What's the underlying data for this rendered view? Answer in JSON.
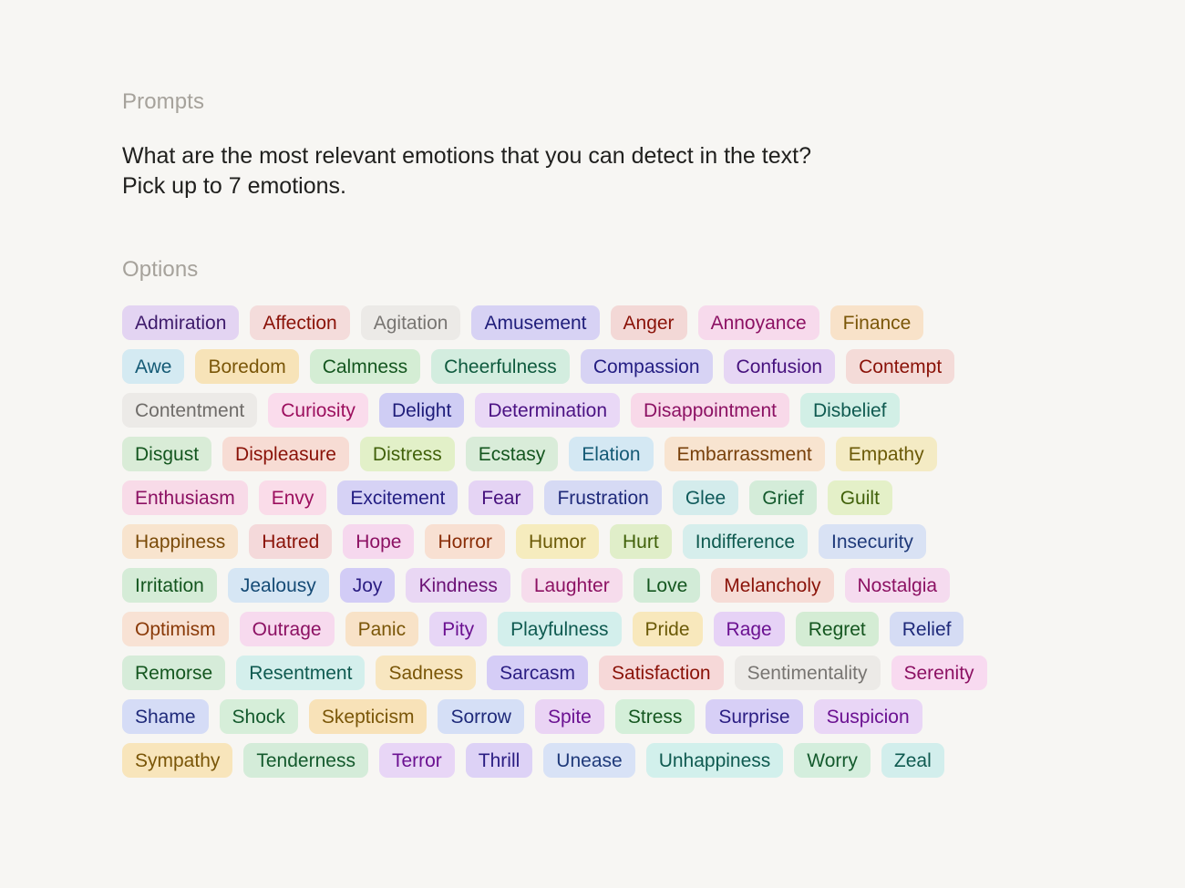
{
  "sections": {
    "prompts_label": "Prompts",
    "options_label": "Options"
  },
  "prompt": {
    "text": "What are the most relevant emotions that you can detect in the text?\nPick up to 7 emotions."
  },
  "options": {
    "rows": [
      [
        {
          "label": "Admiration",
          "bg": "#e3d4f2",
          "fg": "#3e1a6b"
        },
        {
          "label": "Affection",
          "bg": "#f4dcdb",
          "fg": "#8a1208"
        },
        {
          "label": "Agitation",
          "bg": "#eceae7",
          "fg": "#787572"
        },
        {
          "label": "Amusement",
          "bg": "#d7d2f4",
          "fg": "#1f1d7a"
        },
        {
          "label": "Anger",
          "bg": "#f3d8d6",
          "fg": "#8a1208"
        },
        {
          "label": "Annoyance",
          "bg": "#f7daec",
          "fg": "#8c1163"
        },
        {
          "label": "Finance",
          "bg": "#f8e2c9",
          "fg": "#7a5608"
        }
      ],
      [
        {
          "label": "Awe",
          "bg": "#d4eaf2",
          "fg": "#145a75"
        },
        {
          "label": "Boredom",
          "bg": "#f7e3b8",
          "fg": "#7a5608"
        },
        {
          "label": "Calmness",
          "bg": "#d4edd4",
          "fg": "#14561f"
        },
        {
          "label": "Cheerfulness",
          "bg": "#d3eddf",
          "fg": "#0f5a3e"
        },
        {
          "label": "Compassion",
          "bg": "#d7d3f4",
          "fg": "#231d82"
        },
        {
          "label": "Confusion",
          "bg": "#e6d6f4",
          "fg": "#46117d"
        },
        {
          "label": "Contempt",
          "bg": "#f4dbd8",
          "fg": "#8a1208"
        }
      ],
      [
        {
          "label": "Contentment",
          "bg": "#eceae7",
          "fg": "#6f6c69"
        },
        {
          "label": "Curiosity",
          "bg": "#fadcec",
          "fg": "#9c0f5e"
        },
        {
          "label": "Delight",
          "bg": "#cfcdf4",
          "fg": "#1f1d7a"
        },
        {
          "label": "Determination",
          "bg": "#e9d8f6",
          "fg": "#4b1283"
        },
        {
          "label": "Disappointment",
          "bg": "#f8d9e9",
          "fg": "#8c1163"
        },
        {
          "label": "Disbelief",
          "bg": "#d2efe6",
          "fg": "#0f5a50"
        }
      ],
      [
        {
          "label": "Disgust",
          "bg": "#d9ecd7",
          "fg": "#14561f"
        },
        {
          "label": "Displeasure",
          "bg": "#f7dcd4",
          "fg": "#8a1208"
        },
        {
          "label": "Distress",
          "bg": "#e2f0c8",
          "fg": "#41610a"
        },
        {
          "label": "Ecstasy",
          "bg": "#d9ecd9",
          "fg": "#14561f"
        },
        {
          "label": "Elation",
          "bg": "#d4e8f3",
          "fg": "#145a75"
        },
        {
          "label": "Embarrassment",
          "bg": "#f8e4d0",
          "fg": "#78400a"
        },
        {
          "label": "Empathy",
          "bg": "#f4ebc4",
          "fg": "#6b5a07"
        }
      ],
      [
        {
          "label": "Enthusiasm",
          "bg": "#f8dbe8",
          "fg": "#8c1163"
        },
        {
          "label": "Envy",
          "bg": "#fadce9",
          "fg": "#9c0f5e"
        },
        {
          "label": "Excitement",
          "bg": "#d6d2f5",
          "fg": "#231d82"
        },
        {
          "label": "Fear",
          "bg": "#e5d4f4",
          "fg": "#46117d"
        },
        {
          "label": "Frustration",
          "bg": "#d6daf4",
          "fg": "#1f2a7a"
        },
        {
          "label": "Glee",
          "bg": "#d4ecec",
          "fg": "#0f5a5a"
        },
        {
          "label": "Grief",
          "bg": "#d4ecd9",
          "fg": "#145a2d"
        },
        {
          "label": "Guilt",
          "bg": "#e4f0c8",
          "fg": "#41610a"
        }
      ],
      [
        {
          "label": "Happiness",
          "bg": "#f8e4ce",
          "fg": "#7a4a08"
        },
        {
          "label": "Hatred",
          "bg": "#f4d9da",
          "fg": "#8a1208"
        },
        {
          "label": "Hope",
          "bg": "#f6d8ee",
          "fg": "#8c1163"
        },
        {
          "label": "Horror",
          "bg": "#f8e0d2",
          "fg": "#8a2e08"
        },
        {
          "label": "Humor",
          "bg": "#f6ecbe",
          "fg": "#6b5a07"
        },
        {
          "label": "Hurt",
          "bg": "#e0eec9",
          "fg": "#41610a"
        },
        {
          "label": "Indifference",
          "bg": "#d6eeec",
          "fg": "#0f5a50"
        },
        {
          "label": "Insecurity",
          "bg": "#d9e2f4",
          "fg": "#1f3a7a"
        }
      ],
      [
        {
          "label": "Irritation",
          "bg": "#d5ecd7",
          "fg": "#14561f"
        },
        {
          "label": "Jealousy",
          "bg": "#d6e6f4",
          "fg": "#144a75"
        },
        {
          "label": "Joy",
          "bg": "#d2ccf6",
          "fg": "#2a1d82"
        },
        {
          "label": "Kindness",
          "bg": "#e9d7f4",
          "fg": "#6b1175"
        },
        {
          "label": "Laughter",
          "bg": "#f6dcec",
          "fg": "#8c1163"
        },
        {
          "label": "Love",
          "bg": "#d2ebd7",
          "fg": "#14561f"
        },
        {
          "label": "Melancholy",
          "bg": "#f6dcd6",
          "fg": "#8a1208"
        },
        {
          "label": "Nostalgia",
          "bg": "#f5dbef",
          "fg": "#8c1163"
        }
      ],
      [
        {
          "label": "Optimism",
          "bg": "#f8e2d4",
          "fg": "#8a3a08"
        },
        {
          "label": "Outrage",
          "bg": "#f7daee",
          "fg": "#8c1163"
        },
        {
          "label": "Panic",
          "bg": "#f8e2c7",
          "fg": "#7a5608"
        },
        {
          "label": "Pity",
          "bg": "#e7d6f6",
          "fg": "#6b1191"
        },
        {
          "label": "Playfulness",
          "bg": "#d3efec",
          "fg": "#0f5a50"
        },
        {
          "label": "Pride",
          "bg": "#f8e8bc",
          "fg": "#6b5a07"
        },
        {
          "label": "Rage",
          "bg": "#e6d2f6",
          "fg": "#6b1191"
        },
        {
          "label": "Regret",
          "bg": "#d4ecd4",
          "fg": "#14561f"
        },
        {
          "label": "Relief",
          "bg": "#d5dcf4",
          "fg": "#1f2a7a"
        }
      ],
      [
        {
          "label": "Remorse",
          "bg": "#d6ecd9",
          "fg": "#14561f"
        },
        {
          "label": "Resentment",
          "bg": "#d4efec",
          "fg": "#0f5a50"
        },
        {
          "label": "Sadness",
          "bg": "#f8e6c0",
          "fg": "#7a5608"
        },
        {
          "label": "Sarcasm",
          "bg": "#d5cdf6",
          "fg": "#2a1d82"
        },
        {
          "label": "Satisfaction",
          "bg": "#f6d8d8",
          "fg": "#8a1208"
        },
        {
          "label": "Sentimentality",
          "bg": "#eceae7",
          "fg": "#787572"
        },
        {
          "label": "Serenity",
          "bg": "#f8daf0",
          "fg": "#8c1163"
        }
      ],
      [
        {
          "label": "Shame",
          "bg": "#d5dcf6",
          "fg": "#1f2a7a"
        },
        {
          "label": "Shock",
          "bg": "#d6eed9",
          "fg": "#145a2d"
        },
        {
          "label": "Skepticism",
          "bg": "#f8e2b8",
          "fg": "#7a5608"
        },
        {
          "label": "Sorrow",
          "bg": "#d5dff6",
          "fg": "#1f2a7a"
        },
        {
          "label": "Spite",
          "bg": "#ead4f4",
          "fg": "#6b1191"
        },
        {
          "label": "Stress",
          "bg": "#d4efd9",
          "fg": "#14561f"
        },
        {
          "label": "Surprise",
          "bg": "#d7cff6",
          "fg": "#2a1d82"
        },
        {
          "label": "Suspicion",
          "bg": "#e9d6f6",
          "fg": "#6b1191"
        }
      ],
      [
        {
          "label": "Sympathy",
          "bg": "#f8e5bb",
          "fg": "#7a5608"
        },
        {
          "label": "Tenderness",
          "bg": "#d4ecd9",
          "fg": "#145a2d"
        },
        {
          "label": "Terror",
          "bg": "#e8d6f6",
          "fg": "#6b1191"
        },
        {
          "label": "Thrill",
          "bg": "#ddd2f6",
          "fg": "#2a1d82"
        },
        {
          "label": "Unease",
          "bg": "#d8e2f6",
          "fg": "#1f3a7a"
        },
        {
          "label": "Unhappiness",
          "bg": "#d2f0ec",
          "fg": "#0f5a50"
        },
        {
          "label": "Worry",
          "bg": "#d4eedd",
          "fg": "#145a2d"
        },
        {
          "label": "Zeal",
          "bg": "#d2eeec",
          "fg": "#0f5a50"
        }
      ]
    ]
  }
}
